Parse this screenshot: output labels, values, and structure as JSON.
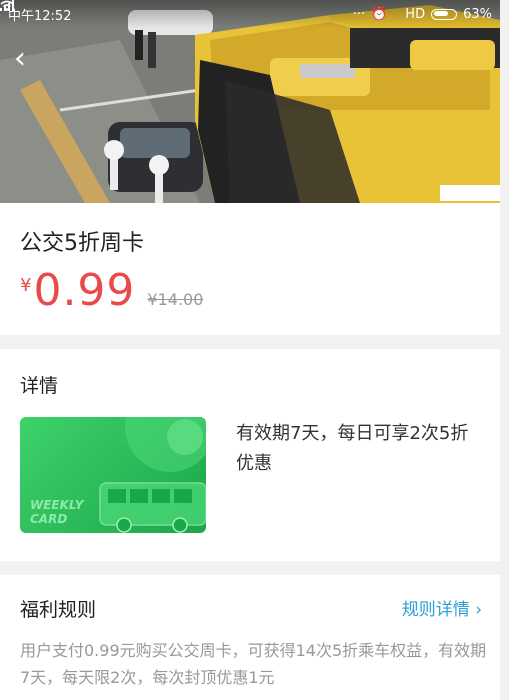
{
  "status_bar": {
    "time": "中午12:52",
    "icons": [
      "more-dots-icon",
      "alarm-icon",
      "wifi-icon",
      "signal-icon"
    ],
    "network": "HD",
    "battery": "63%"
  },
  "header": {
    "back_icon": "back-arrow-icon",
    "back_glyph": "‹"
  },
  "product": {
    "title": "公交5折周卡",
    "currency": "¥",
    "price": "0.99",
    "original_price": "¥14.00"
  },
  "details": {
    "title": "详情",
    "card_label_line1": "WEEKLY",
    "card_label_line2": "CARD",
    "description": "有效期7天，每日可享2次5折优惠"
  },
  "rules": {
    "title": "福利规则",
    "link": "规则详情 ›",
    "text": "用户支付0.99元购买公交周卡，可获得14次5折乘车权益，有效期7天，每天限2次，每次封顶优惠1元"
  },
  "colors": {
    "price": "#e84a4a",
    "link": "#2a9fd6",
    "card_green": "#2cc05a",
    "bus_yellow": "#e8c337"
  }
}
